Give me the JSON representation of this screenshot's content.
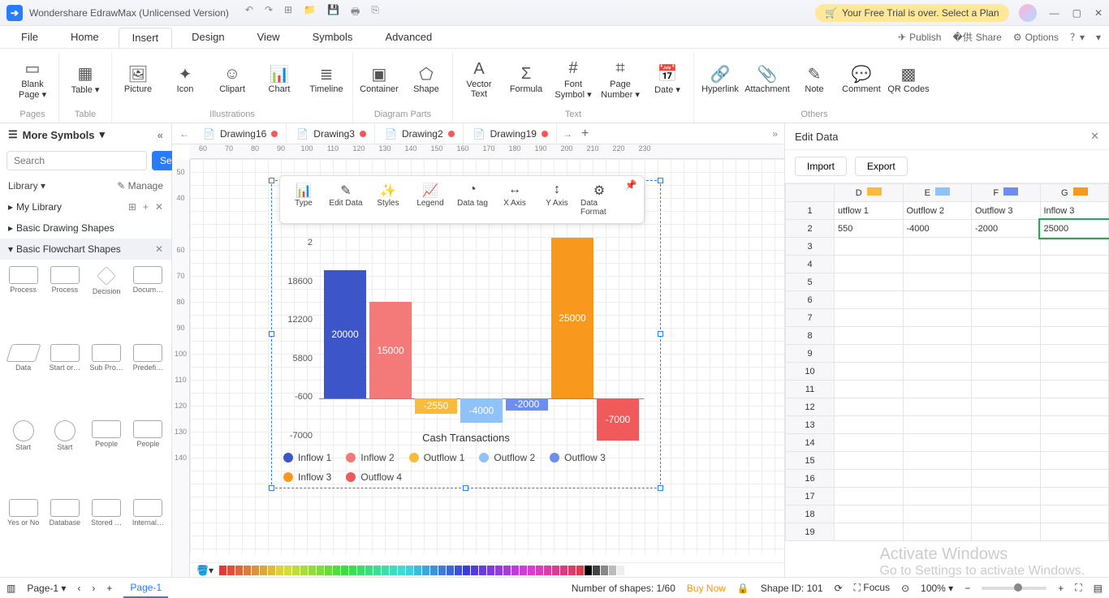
{
  "titlebar": {
    "app_title": "Wondershare EdrawMax (Unlicensed Version)",
    "trial_text": "Your Free Trial is over. Select a Plan"
  },
  "menubar": {
    "tabs": [
      "File",
      "Home",
      "Insert",
      "Design",
      "View",
      "Symbols",
      "Advanced"
    ],
    "active": "Insert",
    "right": {
      "publish": "Publish",
      "share": "Share",
      "options": "Options"
    }
  },
  "ribbon": {
    "groups": [
      {
        "label": "Pages",
        "items": [
          "Blank Page ▾"
        ]
      },
      {
        "label": "Table",
        "items": [
          "Table ▾"
        ]
      },
      {
        "label": "Illustrations",
        "items": [
          "Picture",
          "Icon",
          "Clipart",
          "Chart",
          "Timeline"
        ]
      },
      {
        "label": "Diagram Parts",
        "items": [
          "Container",
          "Shape"
        ]
      },
      {
        "label": "Text",
        "items": [
          "Vector Text",
          "Formula",
          "Font Symbol ▾",
          "Page Number ▾",
          "Date ▾"
        ]
      },
      {
        "label": "Others",
        "items": [
          "Hyperlink",
          "Attachment",
          "Note",
          "Comment",
          "QR Codes"
        ]
      }
    ]
  },
  "left": {
    "header": "More Symbols",
    "search_placeholder": "Search",
    "search_btn": "Search",
    "library": "Library ▾",
    "manage": "✎ Manage",
    "mylib": "My Library",
    "cats": [
      "Basic Drawing Shapes",
      "Basic Flowchart Shapes"
    ],
    "shapes": [
      "Process",
      "Process",
      "Decision",
      "Docum…",
      "Data",
      "Start or…",
      "Sub Pro…",
      "Predefi…",
      "Start",
      "Start",
      "People",
      "People",
      "Yes or No",
      "Database",
      "Stored …",
      "Internal…"
    ]
  },
  "doctabs": [
    "Drawing16",
    "Drawing3",
    "Drawing2",
    "Drawing19"
  ],
  "ruler_h": [
    "60",
    "70",
    "80",
    "90",
    "100",
    "110",
    "120",
    "130",
    "140",
    "150",
    "160",
    "170",
    "180",
    "190",
    "200",
    "210",
    "220",
    "230"
  ],
  "ruler_v": [
    "50",
    "40",
    "",
    "60",
    "70",
    "80",
    "90",
    "100",
    "110",
    "120",
    "130",
    "140"
  ],
  "chart_data": {
    "type": "bar",
    "title": "Cash Transactions",
    "y_ticks": [
      "2",
      "18600",
      "12200",
      "5800",
      "-600",
      "-7000"
    ],
    "series": [
      {
        "name": "Inflow 1",
        "value": 20000,
        "color": "#3c55c9"
      },
      {
        "name": "Inflow 2",
        "value": 15000,
        "color": "#f47a7a"
      },
      {
        "name": "Outflow 1",
        "value": -2550,
        "color": "#fabb3d"
      },
      {
        "name": "Outflow 2",
        "value": -4000,
        "color": "#8fc3f7"
      },
      {
        "name": "Outflow 3",
        "value": -2000,
        "color": "#6b8ef0"
      },
      {
        "name": "Inflow 3",
        "value": 25000,
        "color": "#f8991d"
      },
      {
        "name": "Outflow 4",
        "value": -7000,
        "color": "#f05a5a"
      }
    ],
    "legend": [
      "Inflow 1",
      "Inflow 2",
      "Outflow 1",
      "Outflow 2",
      "Outflow 3",
      "Inflow 3",
      "Outflow 4"
    ],
    "legend_colors": [
      "#3c55c9",
      "#f47a7a",
      "#fabb3d",
      "#8fc3f7",
      "#6b8ef0",
      "#f8991d",
      "#f05a5a"
    ]
  },
  "floatbar": [
    "Type",
    "Edit Data",
    "Styles",
    "Legend",
    "Data tag",
    "X Axis",
    "Y Axis",
    "Data Format"
  ],
  "right": {
    "title": "Edit Data",
    "import": "Import",
    "export": "Export",
    "cols": [
      {
        "h": "D",
        "color": "#fabb3d",
        "label": "utflow 1",
        "val": "550"
      },
      {
        "h": "E",
        "color": "#8fc3f7",
        "label": "Outflow 2",
        "val": "-4000"
      },
      {
        "h": "F",
        "color": "#6b8ef0",
        "label": "Outflow 3",
        "val": "-2000"
      },
      {
        "h": "G",
        "color": "#f8991d",
        "label": "Inflow 3",
        "val": "25000"
      }
    ],
    "rows": 19,
    "selected_cell": "G2"
  },
  "status": {
    "page": "Page-1",
    "shapes": "Number of shapes: 1/60",
    "buy": "Buy Now",
    "shapeid": "Shape ID: 101",
    "focus": "Focus",
    "zoom": "100%  ▾"
  },
  "watermark": {
    "l1": "Activate Windows",
    "l2": "Go to Settings to activate Windows."
  }
}
